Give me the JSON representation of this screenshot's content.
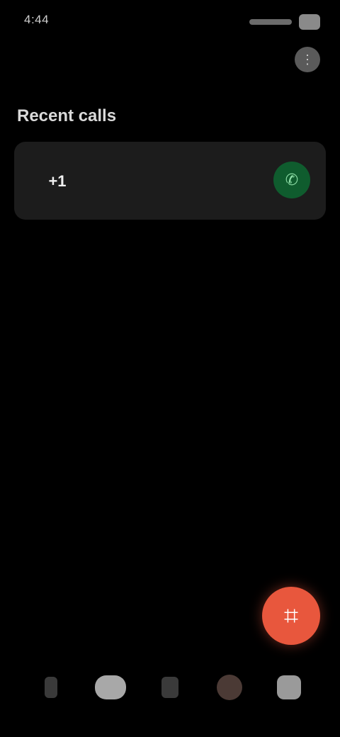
{
  "status_bar": {
    "time": "4:44",
    "icons": [
      "signal-icon",
      "battery-icon"
    ]
  },
  "header": {
    "action_icon": "more-icon"
  },
  "section": {
    "title": "Recent calls"
  },
  "card": {
    "avatar_text": "+1",
    "line1": "",
    "line2": "",
    "line3": "",
    "action_icon": "call-icon",
    "action_color": "#0f5c2e"
  },
  "fab": {
    "icon": "dialpad-icon",
    "color": "#e8573d"
  },
  "bottom_nav": {
    "items": [
      {
        "icon": "star-icon"
      },
      {
        "icon": "recent-icon"
      },
      {
        "icon": "contacts-icon"
      },
      {
        "icon": "profile-icon"
      },
      {
        "icon": "voicemail-icon"
      }
    ]
  }
}
